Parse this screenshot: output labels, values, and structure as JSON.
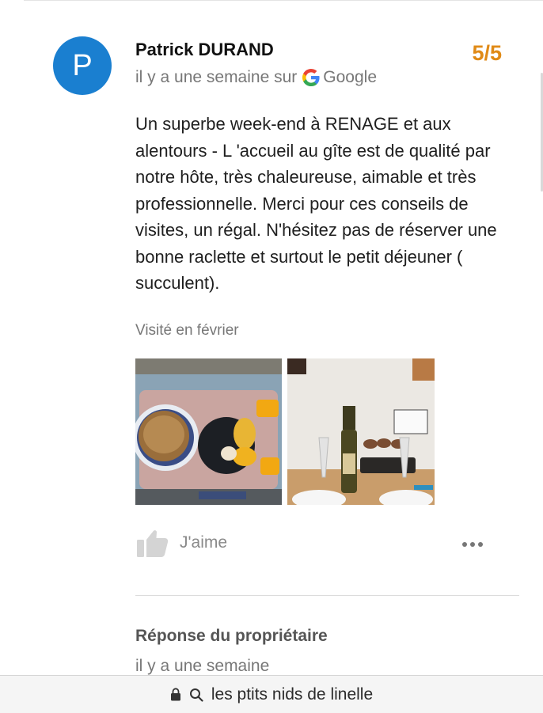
{
  "review": {
    "avatar_letter": "P",
    "author": "Patrick DURAND",
    "rating": "5/5",
    "time_ago": "il y a une semaine sur",
    "source": "Google",
    "text": "Un superbe week-end à RENAGE et aux alentours - L 'accueil au gîte est de qualité par notre hôte, très chaleureuse, aimable et très professionnelle. Merci pour ces conseils de visites, un régal. N'hésitez pas de réserver une bonne raclette et surtout le petit déjeuner ( succulent).",
    "visited": "Visité en février",
    "photos": [
      {
        "icon": "breakfast-tray-photo"
      },
      {
        "icon": "raclette-table-photo"
      }
    ],
    "like_label": "J'aime"
  },
  "owner_response": {
    "heading": "Réponse du propriétaire",
    "date": "il y a une semaine"
  },
  "browser": {
    "url": "les ptits nids de linelle"
  },
  "colors": {
    "avatar": "#1a7fd0",
    "rating": "#e08a16",
    "muted_text": "#777777"
  }
}
